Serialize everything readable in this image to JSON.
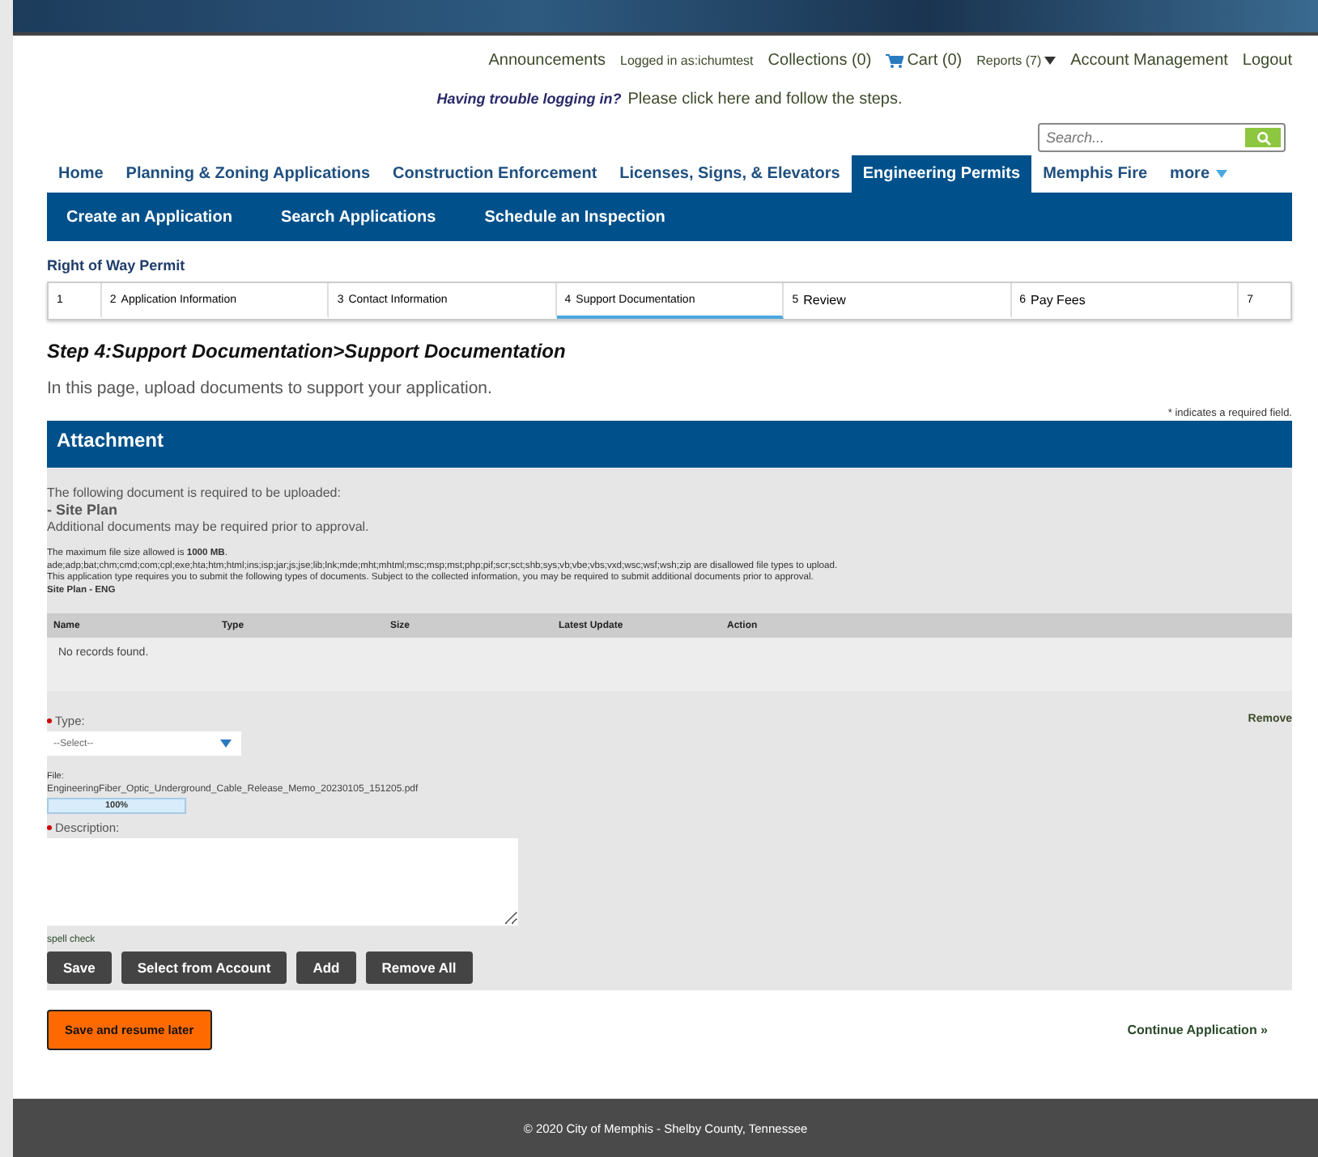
{
  "top_links": [
    {
      "label": "Announcements",
      "kind": "link"
    },
    {
      "label": "Logged in as:ichumtest",
      "kind": "small"
    },
    {
      "label": "Collections (0)",
      "kind": "link"
    },
    {
      "label": "Cart (0)",
      "kind": "cart"
    },
    {
      "label": "Reports (7)",
      "kind": "menu"
    },
    {
      "label": "Account Management",
      "kind": "link"
    },
    {
      "label": "Logout",
      "kind": "link"
    }
  ],
  "login_notice": {
    "question": "Having trouble logging in?",
    "link": "Please click here and follow the steps."
  },
  "search": {
    "placeholder": "Search..."
  },
  "nav_tabs": [
    {
      "label": "Home",
      "selected": false
    },
    {
      "label": "Planning & Zoning Applications",
      "selected": false
    },
    {
      "label": "Construction Enforcement",
      "selected": false
    },
    {
      "label": "Licenses, Signs, & Elevators",
      "selected": false
    },
    {
      "label": "Engineering Permits",
      "selected": true
    },
    {
      "label": "Memphis Fire",
      "selected": false
    },
    {
      "label": "more",
      "selected": false,
      "kind": "menu"
    }
  ],
  "sub_nav": [
    "Create an Application",
    "Search Applications",
    "Schedule an Inspection"
  ],
  "permit_title": "Right of Way Permit",
  "steps": [
    {
      "number": "1",
      "selected": false
    },
    {
      "number": "2",
      "label": "Application Information",
      "selected": false
    },
    {
      "number": "3",
      "label": "Contact Information",
      "selected": false
    },
    {
      "number": "4",
      "label": "Support Documentation",
      "selected": true
    },
    {
      "number": "5",
      "label": "Review",
      "selected": false
    },
    {
      "number": "6",
      "label": "Pay Fees",
      "selected": false
    },
    {
      "number": "7",
      "selected": false
    }
  ],
  "step_heading": "Step 4:Support Documentation>Support Documentation",
  "intro": "In this page, upload documents to support your application.",
  "required_note": "* indicates a required field.",
  "attachment": {
    "title": "Attachment",
    "required_intro": "The following document is required to be uploaded:",
    "required_doc": "- Site Plan",
    "additional_note": "Additional documents may be required prior to approval.",
    "file_size_note": "The maximum file size allowed is **1000 MB**.",
    "disallowed_types": "ade;adp;bat;chm;cmd;com;cpl;exe;hta;htm;html;ins;isp;jar;js;jse;lib;lnk;mde;mht;mhtml;msc;msp;mst;php;pif;scr;sct;shb;sys;vb;vbe;vbs;vxd;wsc;wsf;wsh;zip are disallowed file types to upload.",
    "types_note": "This application type requires you to submit the following types of documents. Subject to the collected information, you may be required to submit additional documents prior to approval.",
    "doc_type": "Site Plan - ENG",
    "table": {
      "columns": [
        "Name",
        "Type",
        "Size",
        "Latest Update",
        "Action"
      ],
      "empty": "No records found."
    },
    "type_label": "Type:",
    "type_required": true,
    "type_value": "--Select--",
    "remove": "Remove",
    "file_label": "File:",
    "file_name": "EngineeringFiber_Optic_Underground_Cable_Release_Memo_20230105_151205.pdf",
    "upload": {
      "level": 1,
      "reading": "100%"
    },
    "description_label": "Description:",
    "description_required": true,
    "spell_check": "spell check",
    "buttons": [
      "Save",
      "Select from Account",
      "Add",
      "Remove All"
    ]
  },
  "save_later": "Save and resume later",
  "continue": "Continue Application »",
  "footer": "© 2020 City of Memphis - Shelby County, Tennessee"
}
